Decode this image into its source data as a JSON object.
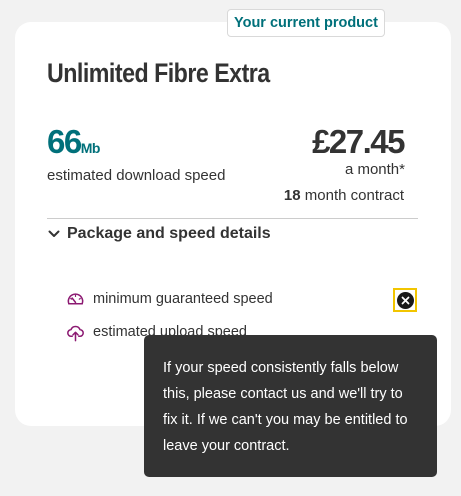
{
  "badge": {
    "label": "Your current product"
  },
  "product": {
    "name": "Unlimited Fibre Extra",
    "speed": {
      "value": "66",
      "unit": "Mb",
      "label": "estimated download speed"
    },
    "price": {
      "amount": "£27.45",
      "period": "a month*"
    },
    "contract": {
      "months": "18",
      "suffix": " month contract"
    }
  },
  "details": {
    "toggle_label": "Package and speed details",
    "features": [
      {
        "icon": "speedometer-icon",
        "label": "minimum guaranteed speed"
      },
      {
        "icon": "cloud-upload-icon",
        "label": "estimated upload speed"
      }
    ]
  },
  "tooltip": {
    "text": "If your speed consistently falls below this, please contact us and we'll try to fix it. If we can't you may be entitled to leave your contract."
  },
  "colors": {
    "accent": "#00707a",
    "icon": "#8c1a72",
    "focus": "#f2c500",
    "tooltip_bg": "#333333",
    "page_bg": "#f2f2f2"
  }
}
